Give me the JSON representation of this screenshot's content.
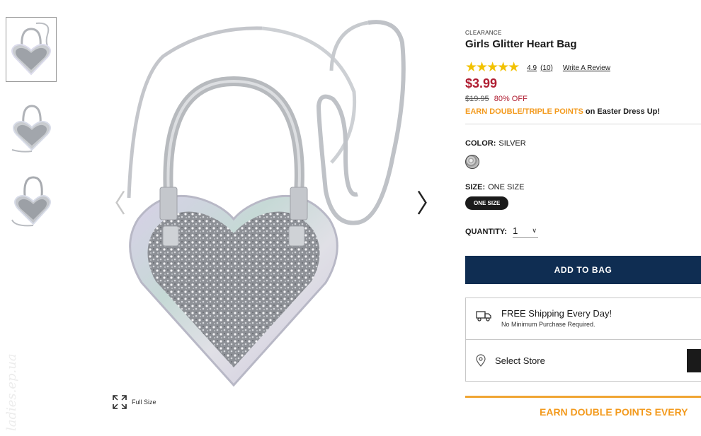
{
  "gallery": {
    "thumbnails": [
      {
        "view": "front",
        "active": true
      },
      {
        "view": "side",
        "active": false
      },
      {
        "view": "angle",
        "active": false
      }
    ],
    "prev_icon": "chevron-left-icon",
    "next_icon": "chevron-right-icon",
    "full_size_label": "Full Size"
  },
  "watermark": "ladies.ep.ua",
  "product": {
    "badge": "CLEARANCE",
    "title": "Girls Glitter Heart Bag",
    "rating": "4.9",
    "rating_stars": 5,
    "review_count": "(10)",
    "write_review": "Write A Review",
    "price": "$3.99",
    "list_price": "$19.95",
    "discount": "80% OFF",
    "points_highlight": "EARN DOUBLE/TRIPLE POINTS",
    "points_rest": " on Easter Dress Up!"
  },
  "options": {
    "color_label": "COLOR:",
    "color_value": "SILVER",
    "size_label": "SIZE:",
    "size_value": "ONE SIZE",
    "size_chip": "ONE SIZE",
    "quantity_label": "QUANTITY:",
    "quantity_value": "1"
  },
  "cart": {
    "add_to_bag": "ADD TO BAG"
  },
  "shipping": {
    "title": "FREE Shipping Every Day!",
    "subtitle": "No Minimum Purchase Required."
  },
  "store": {
    "label": "Select Store"
  },
  "promo": {
    "text": "EARN DOUBLE POINTS EVERY"
  },
  "colors": {
    "price_red": "#b01e32",
    "navy": "#0f2d52",
    "orange": "#f39a1d",
    "star_gold": "#f2c200"
  }
}
